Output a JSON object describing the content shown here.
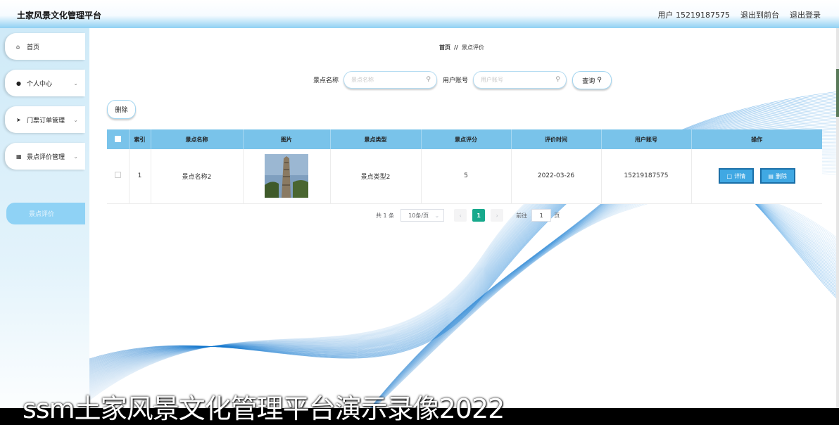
{
  "app": {
    "title": "土家风景文化管理平台",
    "user_label": "用户 15219187575",
    "back_front": "退出到前台",
    "logout": "退出登录"
  },
  "sidebar": {
    "items": [
      {
        "label": "首页",
        "icon": "home-icon"
      },
      {
        "label": "个人中心",
        "icon": "user-icon",
        "chevron": "⌄"
      },
      {
        "label": "门票订单管理",
        "icon": "send-icon",
        "chevron": "⌄"
      },
      {
        "label": "景点评价管理",
        "icon": "edit-icon",
        "chevron": "⌄"
      }
    ],
    "sub_active": "景点评价"
  },
  "breadcrumb": {
    "home": "首页",
    "sep": "//",
    "current": "景点评价"
  },
  "search": {
    "spot_label": "景点名称",
    "spot_placeholder": "景点名称",
    "user_label": "用户账号",
    "user_placeholder": "用户账号",
    "query_label": "查询"
  },
  "actions": {
    "delete_label": "删除"
  },
  "table": {
    "headers": [
      "",
      "索引",
      "景点名称",
      "图片",
      "景点类型",
      "景点评分",
      "评价时间",
      "用户账号",
      "操作"
    ],
    "rows": [
      {
        "index": "1",
        "spot_name": "景点名称2",
        "spot_type": "景点类型2",
        "score": "5",
        "time": "2022-03-26",
        "account": "15219187575",
        "detail_label": "详情",
        "delete_label": "删除"
      }
    ]
  },
  "pagination": {
    "total": "共 1 条",
    "page_size": "10条/页",
    "current_page": "1",
    "goto_label": "前往",
    "goto_value": "1",
    "page_unit": "页"
  },
  "caption": "ssm土家风景文化管理平台演示录像2022",
  "colors": {
    "table_header": "#79c3ea",
    "active_page": "#17a98c",
    "op_button": "#40a8e3",
    "sidebar_active": "#8fd2f5"
  }
}
